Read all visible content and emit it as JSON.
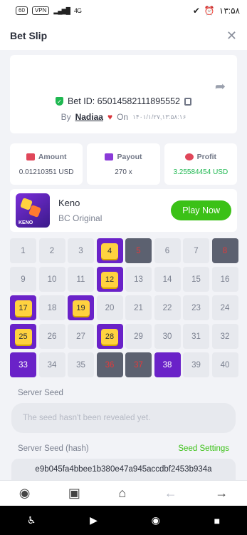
{
  "status": {
    "battery": "60",
    "vpn": "VPN",
    "signal": "4G",
    "time": "۱۳:۵۸"
  },
  "header": {
    "title": "Bet Slip",
    "close": "✕"
  },
  "bet": {
    "id_label": "Bet ID: 65014582111895552",
    "by": "By",
    "user": "Nadiaa",
    "heart": "♥",
    "on": "On",
    "date": "۱۴۰۱/۱/۲۷,۱۳:۵۸:۱۶"
  },
  "stats": [
    {
      "label": "Amount",
      "value": "0.01210351 USD",
      "icon": "wallet-icon"
    },
    {
      "label": "Payout",
      "value": "270 x",
      "icon": "card-icon"
    },
    {
      "label": "Profit",
      "value": "3.25584454 USD",
      "icon": "coins-icon"
    }
  ],
  "game": {
    "name": "Keno",
    "subtitle": "BC Original",
    "thumb_label": "KENO",
    "play": "Play Now"
  },
  "numbers": [
    {
      "n": "1",
      "s": "normal"
    },
    {
      "n": "2",
      "s": "normal"
    },
    {
      "n": "3",
      "s": "normal"
    },
    {
      "n": "4",
      "s": "hit"
    },
    {
      "n": "5",
      "s": "miss"
    },
    {
      "n": "6",
      "s": "normal"
    },
    {
      "n": "7",
      "s": "normal"
    },
    {
      "n": "8",
      "s": "miss"
    },
    {
      "n": "9",
      "s": "normal"
    },
    {
      "n": "10",
      "s": "normal"
    },
    {
      "n": "11",
      "s": "normal"
    },
    {
      "n": "12",
      "s": "hit"
    },
    {
      "n": "13",
      "s": "normal"
    },
    {
      "n": "14",
      "s": "normal"
    },
    {
      "n": "15",
      "s": "normal"
    },
    {
      "n": "16",
      "s": "normal"
    },
    {
      "n": "17",
      "s": "hit"
    },
    {
      "n": "18",
      "s": "normal"
    },
    {
      "n": "19",
      "s": "hit"
    },
    {
      "n": "20",
      "s": "normal"
    },
    {
      "n": "21",
      "s": "normal"
    },
    {
      "n": "22",
      "s": "normal"
    },
    {
      "n": "23",
      "s": "normal"
    },
    {
      "n": "24",
      "s": "normal"
    },
    {
      "n": "25",
      "s": "hit"
    },
    {
      "n": "26",
      "s": "normal"
    },
    {
      "n": "27",
      "s": "normal"
    },
    {
      "n": "28",
      "s": "hit"
    },
    {
      "n": "29",
      "s": "normal"
    },
    {
      "n": "30",
      "s": "normal"
    },
    {
      "n": "31",
      "s": "normal"
    },
    {
      "n": "32",
      "s": "normal"
    },
    {
      "n": "33",
      "s": "pick"
    },
    {
      "n": "34",
      "s": "normal"
    },
    {
      "n": "35",
      "s": "normal"
    },
    {
      "n": "36",
      "s": "miss"
    },
    {
      "n": "37",
      "s": "miss"
    },
    {
      "n": "38",
      "s": "pick"
    },
    {
      "n": "39",
      "s": "normal"
    },
    {
      "n": "40",
      "s": "normal"
    }
  ],
  "server_seed": {
    "label": "Server Seed",
    "placeholder": "The seed hasn't been revealed yet."
  },
  "server_hash": {
    "label": "Server Seed (hash)",
    "settings": "Seed Settings",
    "value": "e9b045fa4bbee1b380e47a945accdbf2453b934a"
  },
  "tabs": [
    "user-icon",
    "wallet-icon",
    "home-icon",
    "back-arrow-icon",
    "forward-arrow-icon"
  ],
  "colors": {
    "accent_green": "#3bc117",
    "purple": "#6a22c8",
    "tile_yellow": "#ffd23f",
    "miss_red": "#e23a3a"
  }
}
